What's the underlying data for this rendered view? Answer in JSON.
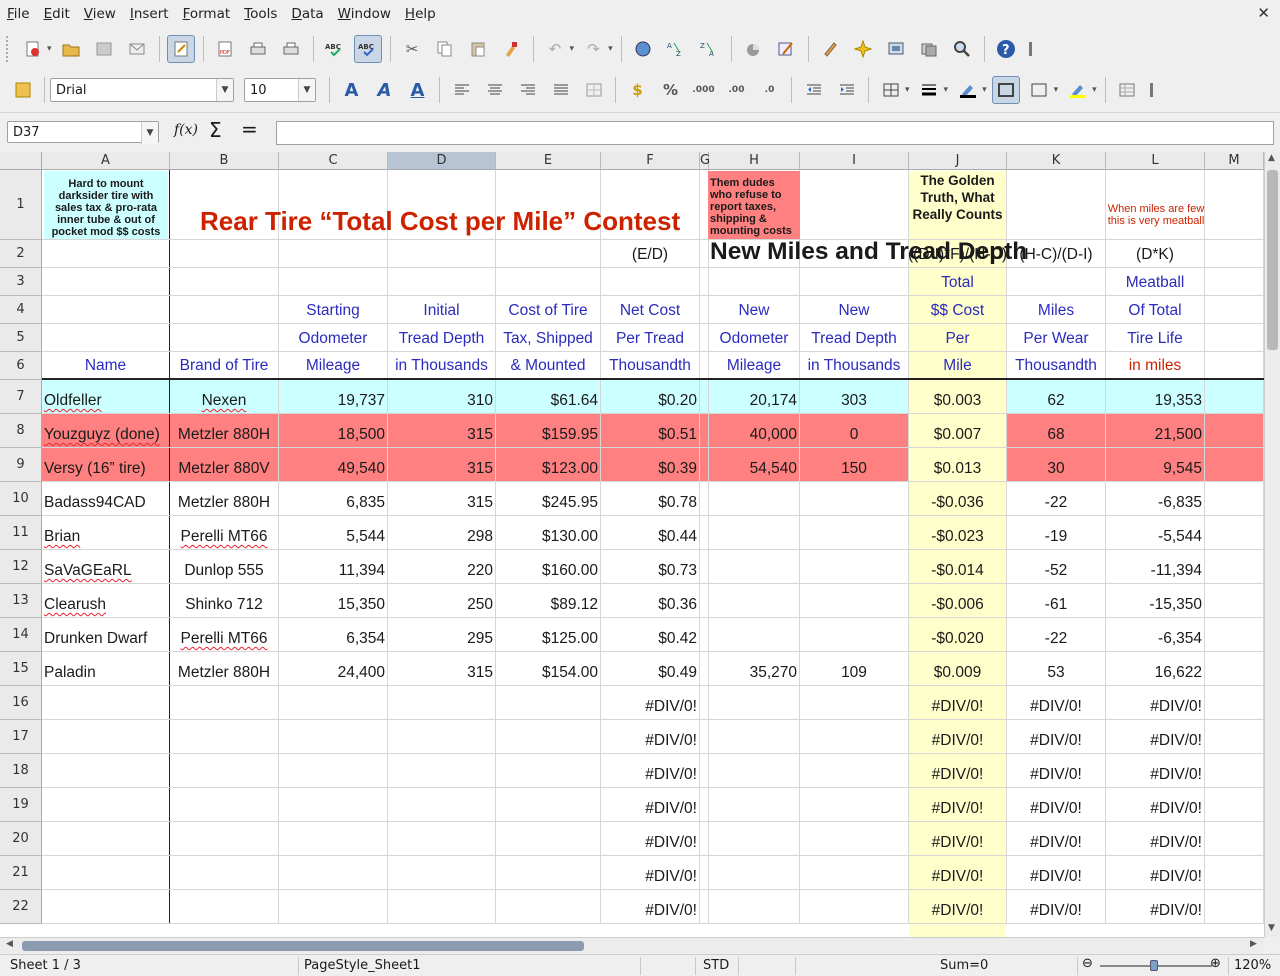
{
  "menu": [
    "File",
    "Edit",
    "View",
    "Insert",
    "Format",
    "Tools",
    "Data",
    "Window",
    "Help"
  ],
  "font": {
    "name": "Drial",
    "size": "10"
  },
  "namebox": "D37",
  "formula_value": "",
  "columns": [
    "A",
    "B",
    "C",
    "D",
    "E",
    "F",
    "G",
    "H",
    "I",
    "J",
    "K",
    "L",
    "M"
  ],
  "selected_column": "D",
  "rows_numbers": [
    "1",
    "2",
    "3",
    "4",
    "5",
    "6",
    "7",
    "8",
    "9",
    "10",
    "11",
    "12",
    "13",
    "14",
    "15",
    "16",
    "17",
    "18",
    "19",
    "20",
    "21",
    "22"
  ],
  "notes": {
    "a1": "Hard to mount darksider tire with sales tax & pro-rata inner tube & out of pocket mod $$ costs",
    "h1": "Them dudes who refuse to report taxes, shipping & mounting costs",
    "j1": "The Golden Truth, What Really Counts",
    "l1": "When miles are few this is very meatball"
  },
  "title": "Rear Tire “Total Cost per Mile” Contest",
  "title_h": "New Miles and Tread Depth",
  "row2": {
    "f": "(E/D)",
    "j": "((D-I)*F)/(H-C)",
    "k": "(H-C)/(D-I)",
    "l": "(D*K)"
  },
  "row3": {
    "j": "Total",
    "l": "Meatball"
  },
  "row4": {
    "c": "Starting",
    "d": "Initial",
    "e": "Cost of Tire",
    "f": "Net Cost",
    "h": "New",
    "i": "New",
    "j": "$$ Cost",
    "k": "Miles",
    "l": "Of Total"
  },
  "row5": {
    "c": "Odometer",
    "d": "Tread Depth",
    "e": "Tax, Shipped",
    "f": "Per Tread",
    "h": "Odometer",
    "i": "Tread Depth",
    "j": "Per",
    "k": "Per Wear",
    "l": "Tire Life"
  },
  "row6": {
    "a": "Name",
    "b": "Brand of Tire",
    "c": "Mileage",
    "d": "in Thousands",
    "e": "& Mounted",
    "f": "Thousandth",
    "h": "Mileage",
    "i": "in Thousands",
    "j": "Mile",
    "k": "Thousandth",
    "l": "in miles"
  },
  "data_rows": [
    {
      "a": "Oldfeller",
      "b": "Nexen",
      "c": "19,737",
      "d": "310",
      "e": "$61.64",
      "f": "$0.20",
      "h": "20,174",
      "i": "303",
      "j": "$0.003",
      "k": "62",
      "l": "19,353"
    },
    {
      "a": "Youzguyz (done)",
      "b": "Metzler 880H",
      "c": "18,500",
      "d": "315",
      "e": "$159.95",
      "f": "$0.51",
      "h": "40,000",
      "i": "0",
      "j": "$0.007",
      "k": "68",
      "l": "21,500"
    },
    {
      "a": "Versy (16” tire)",
      "b": "Metzler 880V",
      "c": "49,540",
      "d": "315",
      "e": "$123.00",
      "f": "$0.39",
      "h": "54,540",
      "i": "150",
      "j": "$0.013",
      "k": "30",
      "l": "9,545"
    },
    {
      "a": "Badass94CAD",
      "b": "Metzler 880H",
      "c": "6,835",
      "d": "315",
      "e": "$245.95",
      "f": "$0.78",
      "h": "",
      "i": "",
      "j": "-$0.036",
      "k": "-22",
      "l": "-6,835"
    },
    {
      "a": "Brian",
      "b": "Perelli MT66",
      "c": "5,544",
      "d": "298",
      "e": "$130.00",
      "f": "$0.44",
      "h": "",
      "i": "",
      "j": "-$0.023",
      "k": "-19",
      "l": "-5,544"
    },
    {
      "a": "SaVaGEaRL",
      "b": "Dunlop 555",
      "c": "11,394",
      "d": "220",
      "e": "$160.00",
      "f": "$0.73",
      "h": "",
      "i": "",
      "j": "-$0.014",
      "k": "-52",
      "l": "-11,394"
    },
    {
      "a": "Clearush",
      "b": "Shinko 712",
      "c": "15,350",
      "d": "250",
      "e": "$89.12",
      "f": "$0.36",
      "h": "",
      "i": "",
      "j": "-$0.006",
      "k": "-61",
      "l": "-15,350"
    },
    {
      "a": "Drunken Dwarf",
      "b": "Perelli MT66",
      "c": "6,354",
      "d": "295",
      "e": "$125.00",
      "f": "$0.42",
      "h": "",
      "i": "",
      "j": "-$0.020",
      "k": "-22",
      "l": "-6,354"
    },
    {
      "a": "Paladin",
      "b": "Metzler 880H",
      "c": "24,400",
      "d": "315",
      "e": "$154.00",
      "f": "$0.49",
      "h": "35,270",
      "i": "109",
      "j": "$0.009",
      "k": "53",
      "l": "16,622"
    }
  ],
  "div_error": "#DIV/0!",
  "status": {
    "sheet": "Sheet 1 / 3",
    "pagestyle": "PageStyle_Sheet1",
    "mode": "STD",
    "sum": "Sum=0",
    "zoom": "120%"
  },
  "colors": {
    "cyan": "#ccffff",
    "salmon": "#ff8080",
    "yellow": "#ffffcc",
    "red_text": "#cc2200",
    "blue_text": "#2b2bbd",
    "selected_header": "#b7c4d4"
  }
}
